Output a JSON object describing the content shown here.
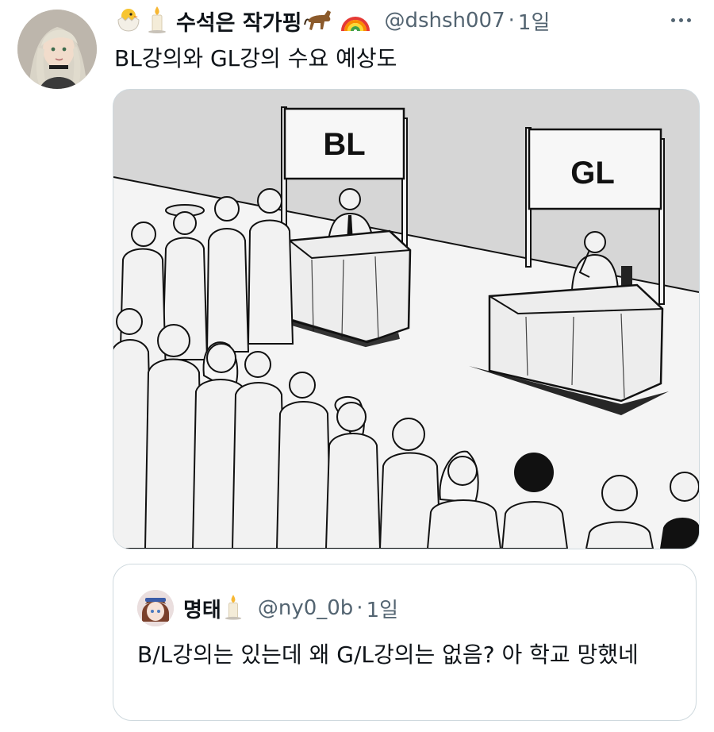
{
  "tweet": {
    "author_name": "수석은 작가핑",
    "author_emojis": [
      "hatching-chick-emoji",
      "candle-emoji"
    ],
    "author_trailing_emojis": [
      "horse-emoji",
      "rainbow-emoji"
    ],
    "handle": "@dshsh007",
    "separator": "·",
    "time": "1일",
    "text": "BL강의와 GL강의 수요 예상도",
    "media": {
      "booth_left_sign": "BL",
      "booth_right_sign": "GL"
    }
  },
  "quote": {
    "author_name": "명태",
    "author_emojis": [
      "candle-emoji"
    ],
    "handle": "@ny0_0b",
    "separator": "·",
    "time": "1일",
    "text": "B/L강의는 있는데 왜 G/L강의는 없음? 아 학교 망했네"
  },
  "colors": {
    "text": "#0f1419",
    "secondary": "#536471",
    "border": "#cfd9de"
  }
}
